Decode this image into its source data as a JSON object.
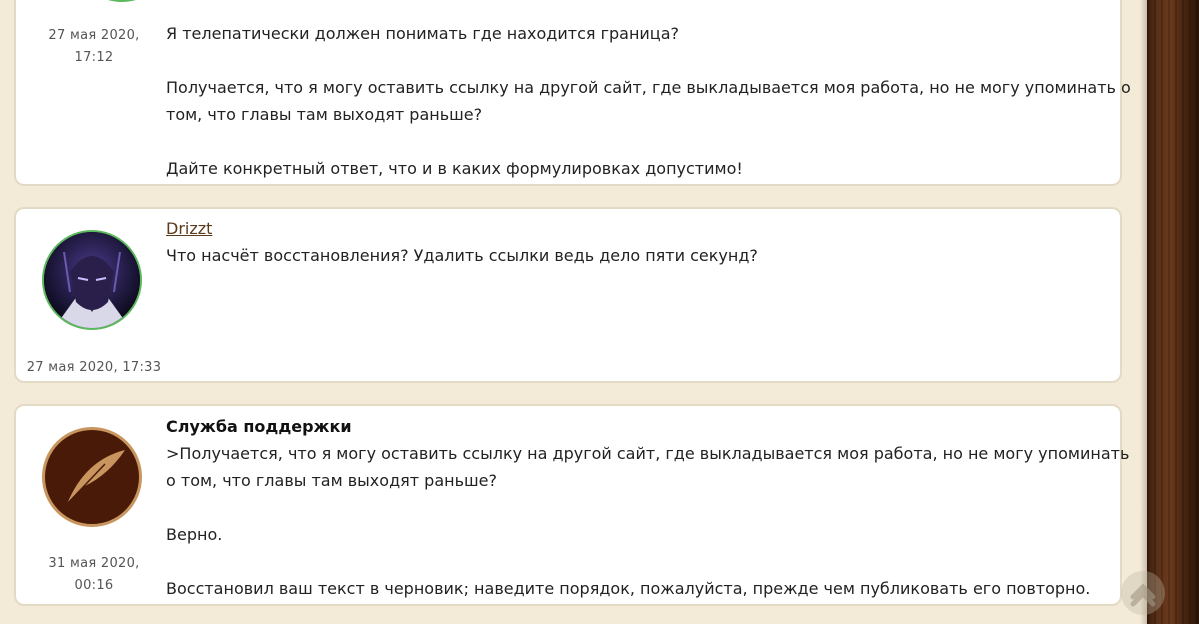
{
  "posts": [
    {
      "date_line1": "27 мая 2020,",
      "date_line2": "17:12",
      "paragraphs": [
        "Я телепатически должен понимать где находится граница?",
        "Получается, что я могу оставить ссылку на другой сайт, где выкладывается моя работа, но не могу упоминать о",
        "том, что главы там выходят раньше?",
        "Дайте конкретный ответ, что и в каких формулировках допустимо!"
      ]
    },
    {
      "author": "Drizzt",
      "date": "27 мая 2020, 17:33",
      "paragraphs": [
        "Что насчёт восстановления? Удалить ссылки ведь дело пяти секунд?"
      ]
    },
    {
      "author": "Служба поддержки",
      "date_line1": "31 мая 2020,",
      "date_line2": "00:16",
      "paragraphs": [
        ">Получается, что я могу оставить ссылку на другой сайт, где выкладывается моя работа, но не могу упоминать",
        "о том, что главы там выходят раньше?",
        "Верно.",
        "Восстановил ваш текст в черновик; наведите порядок, пожалуйста, прежде чем публиковать его повторно."
      ]
    }
  ]
}
